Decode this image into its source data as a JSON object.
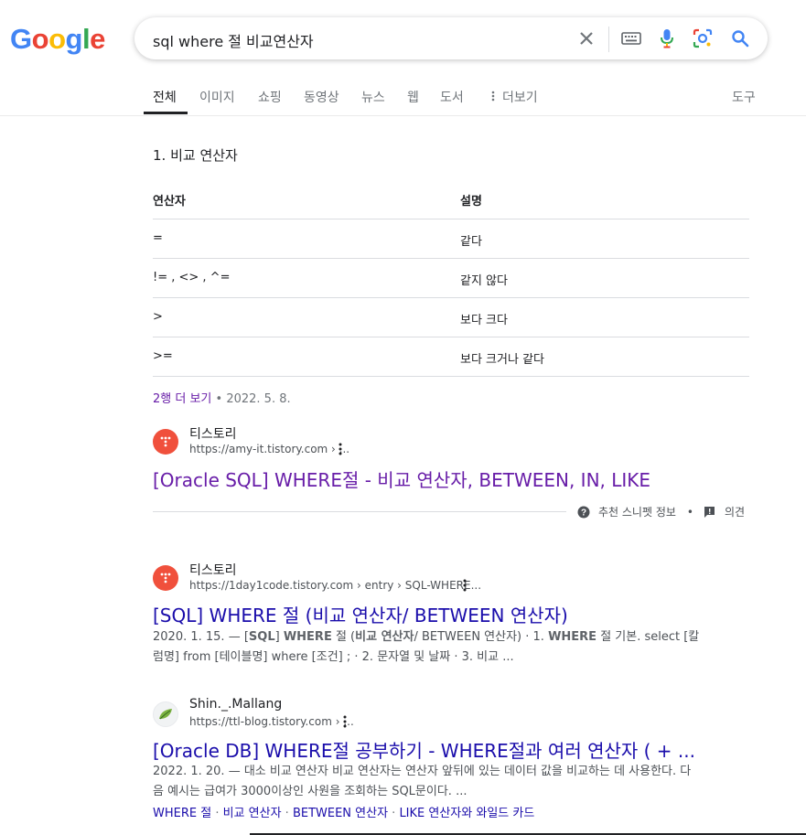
{
  "logo": {
    "letters": [
      "G",
      "o",
      "o",
      "g",
      "l",
      "e"
    ],
    "colors": [
      "#4285F4",
      "#EA4335",
      "#FBBC05",
      "#4285F4",
      "#34A853",
      "#EA4335"
    ]
  },
  "search": {
    "query": "sql where 절 비교연산자"
  },
  "tabs": [
    {
      "label": "전체",
      "active": true
    },
    {
      "label": "이미지"
    },
    {
      "label": "쇼핑"
    },
    {
      "label": "동영상"
    },
    {
      "label": "뉴스"
    },
    {
      "label": "웹"
    },
    {
      "label": "도서"
    },
    {
      "label": "더보기"
    },
    {
      "label": "도구"
    }
  ],
  "snippet": {
    "title": "1. 비교 연산자",
    "header": [
      "연산자",
      "설명"
    ],
    "rows": [
      [
        "=",
        "같다"
      ],
      [
        "!= , <> , ^=",
        "같지 않다"
      ],
      [
        ">",
        "보다 크다"
      ],
      [
        ">=",
        "보다 크거나 같다"
      ]
    ],
    "more_link": "2행 더 보기",
    "date": "• 2022. 5. 8.",
    "site_name": "티스토리",
    "site_url": "https://amy-it.tistory.com › ...",
    "result_title": "[Oracle SQL] WHERE절 - 비교 연산자, BETWEEN, IN, LIKE",
    "about": "추천 스니펫 정보",
    "dot": "•",
    "feedback": "의견"
  },
  "results": [
    {
      "site_name": "티스토리",
      "site_url": "https://1day1code.tistory.com › entry › SQL-WHERE...",
      "title": "[SQL] WHERE 절 (비교 연산자/ BETWEEN 연산자)",
      "desc_parts": [
        {
          "t": "2020. 1. 15. — ["
        },
        {
          "t": "SQL",
          "b": true
        },
        {
          "t": "] "
        },
        {
          "t": "WHERE",
          "b": true
        },
        {
          "t": " 절 ("
        },
        {
          "t": "비교 연산자",
          "b": true
        },
        {
          "t": "/ BETWEEN 연산자) · 1. "
        },
        {
          "t": "WHERE",
          "b": true
        },
        {
          "t": " 절 기본. select [칼럼명] from [테이블명] where [조건] ; · 2. 문자열 및 날짜 · 3. 비교 ..."
        }
      ]
    },
    {
      "site_name": "Shin._.Mallang",
      "site_url": "https://ttl-blog.tistory.com › ...",
      "title": "[Oracle DB] WHERE절 공부하기 - WHERE절과 여러 연산자 ( + ...",
      "desc": "2022. 1. 20. — 대소 비교 연산자 비교 연산자는 연산자 앞뒤에 있는 데이터 값을 비교하는 데 사용한다. 다음 예시는 급여가 3000이상인 사원을 조회하는 SQL문이다. ...",
      "sitelinks": [
        "WHERE 절",
        "비교 연산자",
        "BETWEEN 연산자",
        "LIKE 연산자와 와일드 카드"
      ],
      "sitelink_sep": " · "
    }
  ],
  "colors": {
    "link": "#1a0dab",
    "visited": "#681da8",
    "tistory": "#f0503c"
  }
}
